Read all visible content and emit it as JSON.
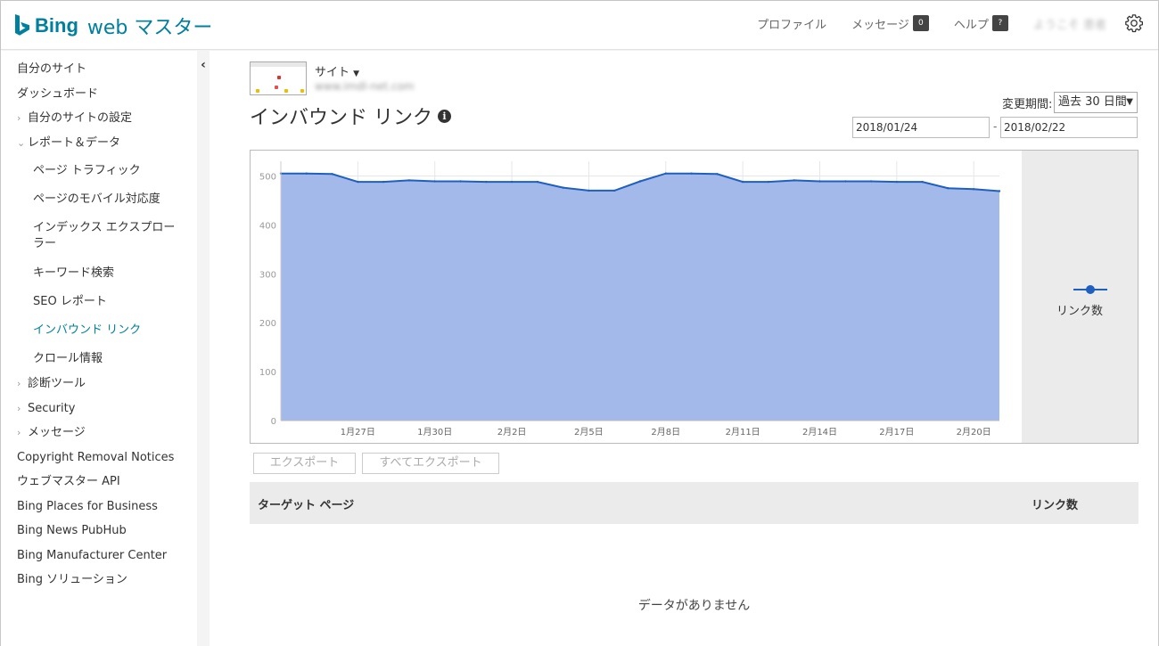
{
  "header": {
    "brand": "Bing",
    "brand_rest": "web マスター",
    "nav": {
      "profile": "プロファイル",
      "messages": "メッセージ",
      "messages_count": "0",
      "help": "ヘルプ",
      "help_count": "?",
      "welcome": "ようこそ 患者"
    },
    "brand_color": "#00809d"
  },
  "sidebar": {
    "items": [
      {
        "label": "自分のサイト"
      },
      {
        "label": "ダッシュボード"
      },
      {
        "label": "自分のサイトの設定"
      },
      {
        "label": "レポート＆データ"
      },
      {
        "label": "ページ トラフィック"
      },
      {
        "label": "ページのモバイル対応度"
      },
      {
        "label": "インデックス エクスプローラー"
      },
      {
        "label": "キーワード検索"
      },
      {
        "label": "SEO レポート"
      },
      {
        "label": "インバウンド リンク"
      },
      {
        "label": "クロール情報"
      },
      {
        "label": "診断ツール"
      },
      {
        "label": "Security"
      },
      {
        "label": "メッセージ"
      },
      {
        "label": "Copyright Removal Notices"
      },
      {
        "label": "ウェブマスター API"
      },
      {
        "label": "Bing Places for Business"
      },
      {
        "label": "Bing News PubHub"
      },
      {
        "label": "Bing Manufacturer Center"
      },
      {
        "label": "Bing ソリューション"
      }
    ]
  },
  "main": {
    "site_label": "サイト",
    "site_url": "www.imdl-net.com",
    "title": "インバウンド リンク",
    "period_label": "変更期間:",
    "period_value": "過去 30 日間",
    "date_from": "2018/01/24",
    "date_to": "2018/02/22",
    "date_sep": "-",
    "export": "エクスポート",
    "export_all": "すべてエクスポート",
    "table": {
      "col1": "ターゲット ページ",
      "col2": "リンク数"
    },
    "no_data": "データがありません"
  },
  "chart_data": {
    "type": "area",
    "series": [
      {
        "name": "リンク数",
        "color": "#1f5fbf",
        "fill": "#a3b9ea",
        "values": [
          505,
          505,
          504,
          488,
          488,
          491,
          489,
          489,
          488,
          488,
          488,
          476,
          470,
          470,
          489,
          505,
          505,
          504,
          488,
          488,
          491,
          489,
          489,
          489,
          488,
          488,
          475,
          473,
          469
        ]
      }
    ],
    "x_ticks": [
      "1月27日",
      "1月30日",
      "2月2日",
      "2月5日",
      "2月8日",
      "2月11日",
      "2月14日",
      "2月17日",
      "2月20日"
    ],
    "y_ticks": [
      "0",
      "100",
      "200",
      "300",
      "400",
      "500"
    ],
    "ylim": [
      0,
      530
    ]
  }
}
